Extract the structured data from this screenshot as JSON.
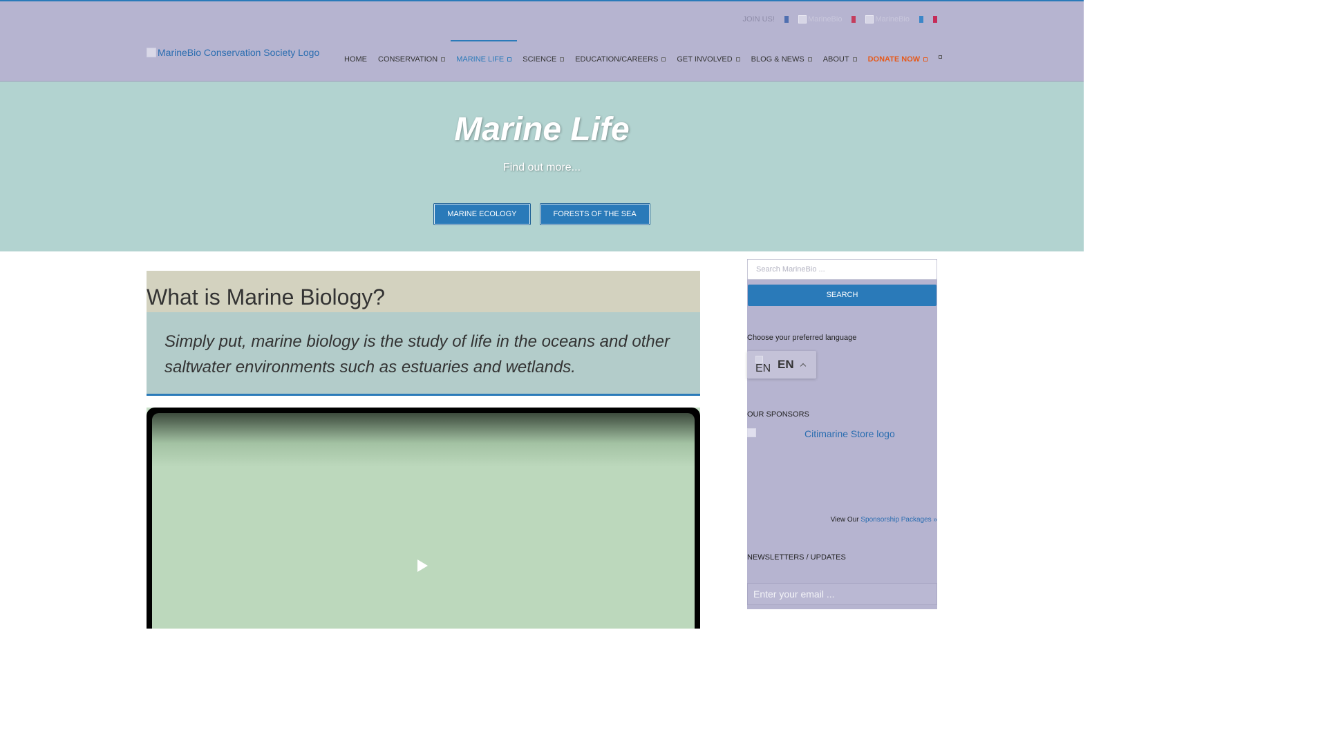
{
  "topbar": {
    "join_label": "JOIN US!",
    "image_alt_1": "MarineBio",
    "image_alt_2": "MarineBio"
  },
  "nav": {
    "logo_alt": "MarineBio Conservation Society Logo",
    "items": [
      {
        "label": "HOME"
      },
      {
        "label": "CONSERVATION"
      },
      {
        "label": "MARINE LIFE"
      },
      {
        "label": "SCIENCE"
      },
      {
        "label": "EDUCATION/CAREERS"
      },
      {
        "label": "GET INVOLVED"
      },
      {
        "label": "BLOG & NEWS"
      },
      {
        "label": "ABOUT"
      },
      {
        "label": "DONATE NOW"
      }
    ]
  },
  "hero": {
    "title": "Marine Life",
    "subtitle": "Find out more...",
    "buttons": [
      {
        "label": "MARINE ECOLOGY"
      },
      {
        "label": "FORESTS OF THE SEA"
      }
    ]
  },
  "content": {
    "heading": "What is Marine Biology?",
    "intro": "Simply put, marine biology is the study of life in the oceans and other saltwater environments such as estuaries and wetlands."
  },
  "sidebar": {
    "search_placeholder": "Search MarineBio ...",
    "search_button": "SEARCH",
    "language_label": "Choose your preferred language",
    "language_flag_alt": "EN",
    "language_code": "EN",
    "sponsors_title": "OUR SPONSORS",
    "sponsor_logo_alt": "Citimarine Store logo",
    "sponsorship_prefix": "View Our",
    "sponsorship_link": "Sponsorship Packages »",
    "newsletter_title": "NEWSLETTERS / UPDATES",
    "email_placeholder": "Enter your email ..."
  },
  "colors": {
    "accent": "#2a7ab9",
    "bar_bg": "#b6b4d0",
    "hero_bg": "#b2d3d0",
    "donate": "#e65a1c"
  }
}
